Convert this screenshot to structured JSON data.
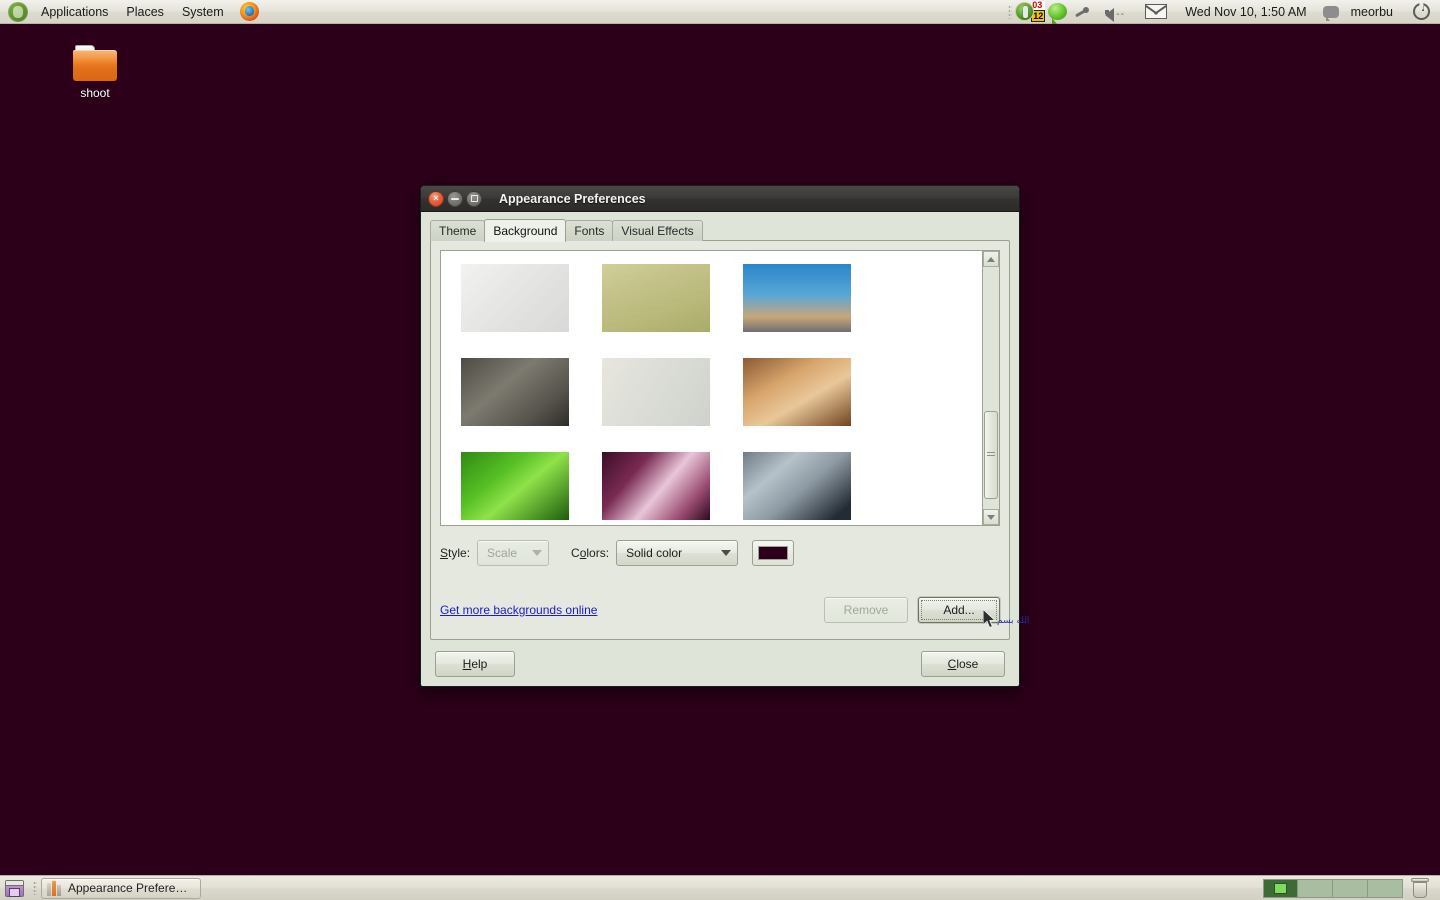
{
  "top_panel": {
    "logo_icon": "ubuntu-logo-icon",
    "menus": [
      "Applications",
      "Places",
      "System"
    ],
    "browser_icon": "firefox-icon",
    "tray": {
      "handle_icon": "panel-drag-handle-icon",
      "keyboard_indicator_icon": "keyboard-indicator-icon",
      "badge_top": "03",
      "badge_bottom": "12",
      "chat_bubble_icon": "chat-bubble-icon",
      "network_icon": "network-disconnected-icon",
      "volume_icon": "volume-icon",
      "volume_dots": "--",
      "mail_icon": "mail-envelope-icon",
      "clock": "Wed Nov 10,  1:50 AM",
      "me_menu_icon": "me-menu-icon",
      "username": "meorbu",
      "power_icon": "power-session-icon"
    }
  },
  "desktop": {
    "background_color": "#2c0019",
    "icons": [
      {
        "name": "shoot",
        "label": "shoot",
        "icon": "folder-icon"
      }
    ],
    "overlay_text": "الله  بسم",
    "cursor_icon": "mouse-pointer-icon"
  },
  "dialog": {
    "title": "Appearance Preferences",
    "window_buttons": {
      "close": "close-window-button",
      "minimize": "minimize-window-button",
      "maximize": "maximize-window-button",
      "close_glyph": "×"
    },
    "tabs": [
      {
        "label": "Theme",
        "active": false
      },
      {
        "label": "Background",
        "active": true
      },
      {
        "label": "Fonts",
        "active": false
      },
      {
        "label": "Visual Effects",
        "active": false
      }
    ],
    "wallpapers": [
      [
        {
          "name": "dalmatian-dog-wallpaper",
          "gradient": "linear-gradient(135deg,#f2f2f0 0%,#e7e7e5 40%,#d8d8d6 100%)"
        },
        {
          "name": "dandelion-grass-wallpaper",
          "gradient": "linear-gradient(160deg,#cfd09a 0%,#c3c188 35%,#b7b878 70%,#a9ab6b 100%)"
        },
        {
          "name": "blue-sky-sunset-wallpaper",
          "gradient": "linear-gradient(180deg,#2b86c8 0%,#58a6d8 45%,#c9a679 78%,#6d6e72 100%)"
        }
      ],
      [
        {
          "name": "rope-knot-wallpaper",
          "gradient": "linear-gradient(140deg,#4e4b45 0%,#7d7a70 40%,#56534c 75%,#2e2c28 100%)"
        },
        {
          "name": "red-leaves-fog-wallpaper",
          "gradient": "linear-gradient(120deg,#e8e6de 0%,#ddded8 40%,#cfd2cc 100%)"
        },
        {
          "name": "cinnamon-sticks-wallpaper",
          "gradient": "linear-gradient(150deg,#8a5a33 0%,#d8a56c 35%,#e9c79a 60%,#70441f 100%)"
        }
      ],
      [
        {
          "name": "green-fern-curl-wallpaper",
          "gradient": "linear-gradient(140deg,#2f8a14 0%,#57c025 35%,#8fe24a 55%,#1d5c0c 100%)"
        },
        {
          "name": "purple-light-bokeh-wallpaper",
          "gradient": "linear-gradient(130deg,#3a0d26 0%,#7a2a52 30%,#e8c6d8 55%,#9a4b70 80%,#2b0a1c 100%)"
        },
        {
          "name": "water-droplet-macro-wallpaper",
          "gradient": "linear-gradient(140deg,#6f7c86 0%,#b6c2c9 30%,#8e9aa3 55%,#232c34 90%)"
        }
      ]
    ],
    "scrollbar": {
      "up_arrow": "scroll-up-arrow-icon",
      "down_arrow": "scroll-down-arrow-icon",
      "thumb": "scrollbar-thumb"
    },
    "options": {
      "style_label": "Style:",
      "style_label_mnemonic": "S",
      "style_value": "Scale",
      "style_disabled": true,
      "colors_label": "Colors:",
      "colors_label_mnemonic": "o",
      "colors_value": "Solid color",
      "swatch_color": "#2c0019"
    },
    "links": {
      "more_backgrounds": "Get more backgrounds online",
      "more_backgrounds_color": "#1c1ccc"
    },
    "buttons": {
      "remove": "Remove",
      "remove_disabled": true,
      "add": "Add...",
      "add_focused": true,
      "help": "Help",
      "help_mnemonic": "H",
      "close": "Close",
      "close_mnemonic": "C"
    }
  },
  "bottom_panel": {
    "show_desktop_icon": "show-desktop-icon",
    "task": {
      "label": "Appearance Preferen...",
      "icon": "appearance-preferences-icon"
    },
    "workspaces": [
      {
        "name": "workspace-1",
        "active": true
      },
      {
        "name": "workspace-2",
        "active": false
      },
      {
        "name": "workspace-3",
        "active": false
      },
      {
        "name": "workspace-4",
        "active": false
      }
    ],
    "trash_icon": "trash-icon"
  }
}
